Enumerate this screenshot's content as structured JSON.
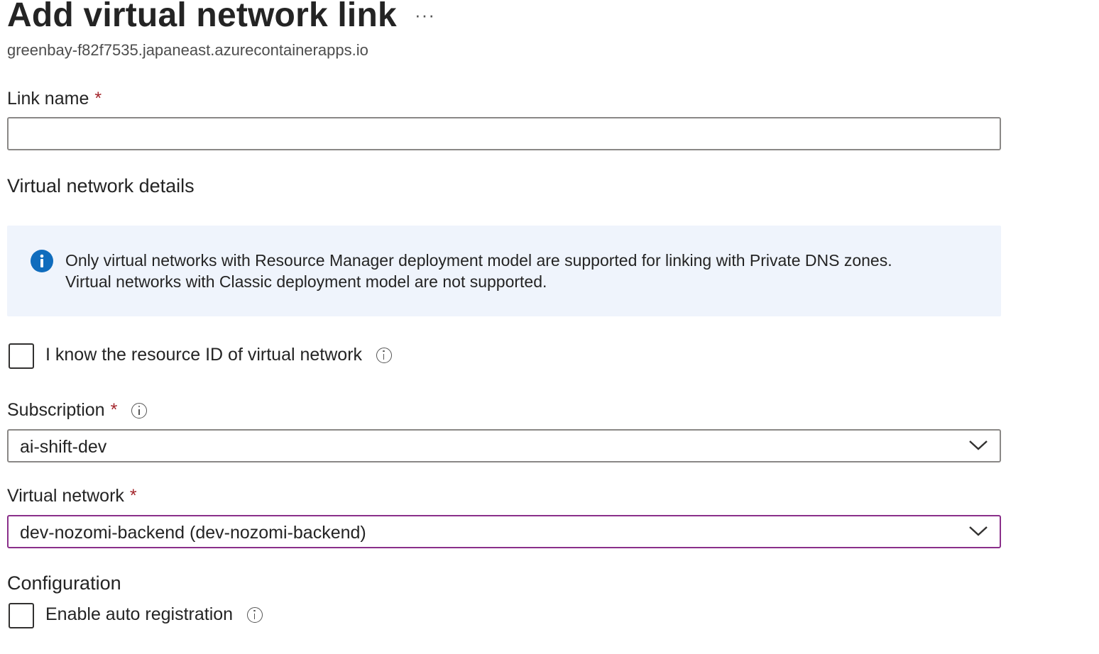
{
  "header": {
    "title": "Add virtual network link",
    "more_glyph": "···",
    "subtitle": "greenbay-f82f7535.japaneast.azurecontainerapps.io"
  },
  "link_name": {
    "label": "Link name",
    "required_marker": "*",
    "value": "",
    "placeholder": ""
  },
  "vnet_details": {
    "heading": "Virtual network details",
    "info_line1": "Only virtual networks with Resource Manager deployment model are supported for linking with Private DNS zones.",
    "info_line2": "Virtual networks with Classic deployment model are not supported.",
    "info_icon": "info-filled-icon",
    "info_color": "#0f6cbd"
  },
  "resource_id_checkbox": {
    "label": "I know the resource ID of virtual network",
    "checked": false
  },
  "subscription": {
    "label": "Subscription",
    "required_marker": "*",
    "value": "ai-shift-dev"
  },
  "virtual_network": {
    "label": "Virtual network",
    "required_marker": "*",
    "value": "dev-nozomi-backend (dev-nozomi-backend)",
    "focus_color": "#8a2f8a"
  },
  "configuration": {
    "heading": "Configuration",
    "auto_registration_label": "Enable auto registration",
    "auto_registration_checked": false
  },
  "colors": {
    "required": "#a4262c",
    "info_background": "#eff4fc",
    "border": "#8a8886"
  }
}
